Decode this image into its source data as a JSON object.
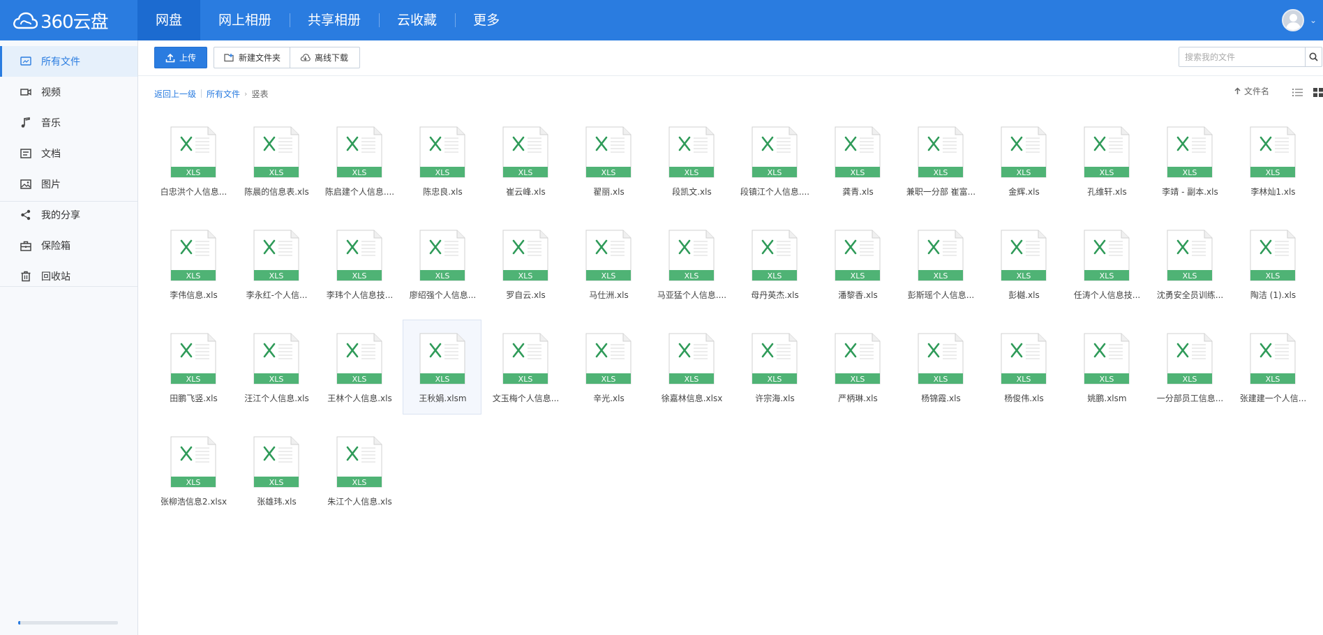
{
  "app": {
    "logo_text": "360云盘",
    "nav": [
      {
        "label": "网盘",
        "active": true
      },
      {
        "label": "网上相册",
        "active": false
      },
      {
        "label": "共享相册",
        "active": false
      },
      {
        "label": "云收藏",
        "active": false
      },
      {
        "label": "更多",
        "active": false
      }
    ],
    "accent_color": "#2a7ce0"
  },
  "sidebar": {
    "items": [
      {
        "label": "所有文件",
        "icon": "all-files-icon",
        "active": true
      },
      {
        "label": "视频",
        "icon": "video-icon",
        "active": false
      },
      {
        "label": "音乐",
        "icon": "music-icon",
        "active": false
      },
      {
        "label": "文档",
        "icon": "document-icon",
        "active": false
      },
      {
        "label": "图片",
        "icon": "image-icon",
        "active": false
      },
      {
        "label": "我的分享",
        "icon": "share-icon",
        "active": false
      },
      {
        "label": "保险箱",
        "icon": "safe-box-icon",
        "active": false
      },
      {
        "label": "回收站",
        "icon": "trash-icon",
        "active": false
      }
    ],
    "storage_used_fraction": 0.02
  },
  "toolbar": {
    "upload_label": "上传",
    "new_folder_label": "新建文件夹",
    "offline_download_label": "离线下载",
    "search_placeholder": "搜索我的文件"
  },
  "breadcrumb": {
    "back_label": "返回上一级",
    "root_label": "所有文件",
    "current_label": "竖表"
  },
  "sort": {
    "label": "文件名"
  },
  "file_badge": "XLS",
  "files": [
    {
      "name": "白忠洪个人信息..."
    },
    {
      "name": "陈晨的信息表.xls"
    },
    {
      "name": "陈启建个人信息...."
    },
    {
      "name": "陈忠良.xls"
    },
    {
      "name": "崔云峰.xls"
    },
    {
      "name": "翟丽.xls"
    },
    {
      "name": "段凯文.xls"
    },
    {
      "name": "段镇江个人信息...."
    },
    {
      "name": "龚青.xls"
    },
    {
      "name": "兼职一分部 崔富..."
    },
    {
      "name": "金辉.xls"
    },
    {
      "name": "孔维轩.xls"
    },
    {
      "name": "李靖 - 副本.xls"
    },
    {
      "name": "李林灿1.xls"
    },
    {
      "name": "李伟信息.xls"
    },
    {
      "name": "李永红-个人信..."
    },
    {
      "name": "李玮个人信息技..."
    },
    {
      "name": "廖绍强个人信息..."
    },
    {
      "name": "罗自云.xls"
    },
    {
      "name": "马仕洲.xls"
    },
    {
      "name": "马亚猛个人信息...."
    },
    {
      "name": "母丹英杰.xls"
    },
    {
      "name": "潘黎香.xls"
    },
    {
      "name": "彭斯瑶个人信息..."
    },
    {
      "name": "彭樾.xls"
    },
    {
      "name": "任涛个人信息技..."
    },
    {
      "name": "沈勇安全员训练..."
    },
    {
      "name": "陶洁 (1).xls"
    },
    {
      "name": "田鹏飞竖.xls"
    },
    {
      "name": "汪江个人信息.xls"
    },
    {
      "name": "王林个人信息.xls"
    },
    {
      "name": "王秋娟.xlsm",
      "selected": true
    },
    {
      "name": "文玉梅个人信息..."
    },
    {
      "name": "辛光.xls"
    },
    {
      "name": "徐嘉林信息.xlsx"
    },
    {
      "name": "许宗海.xls"
    },
    {
      "name": "严柄琳.xls"
    },
    {
      "name": "杨锦霞.xls"
    },
    {
      "name": "杨俊伟.xls"
    },
    {
      "name": "姚鹏.xlsm"
    },
    {
      "name": "一分部员工信息..."
    },
    {
      "name": "张建建一个人信..."
    },
    {
      "name": "张柳浩信息2.xlsx"
    },
    {
      "name": "张雄玮.xls"
    },
    {
      "name": "朱江个人信息.xls"
    }
  ]
}
